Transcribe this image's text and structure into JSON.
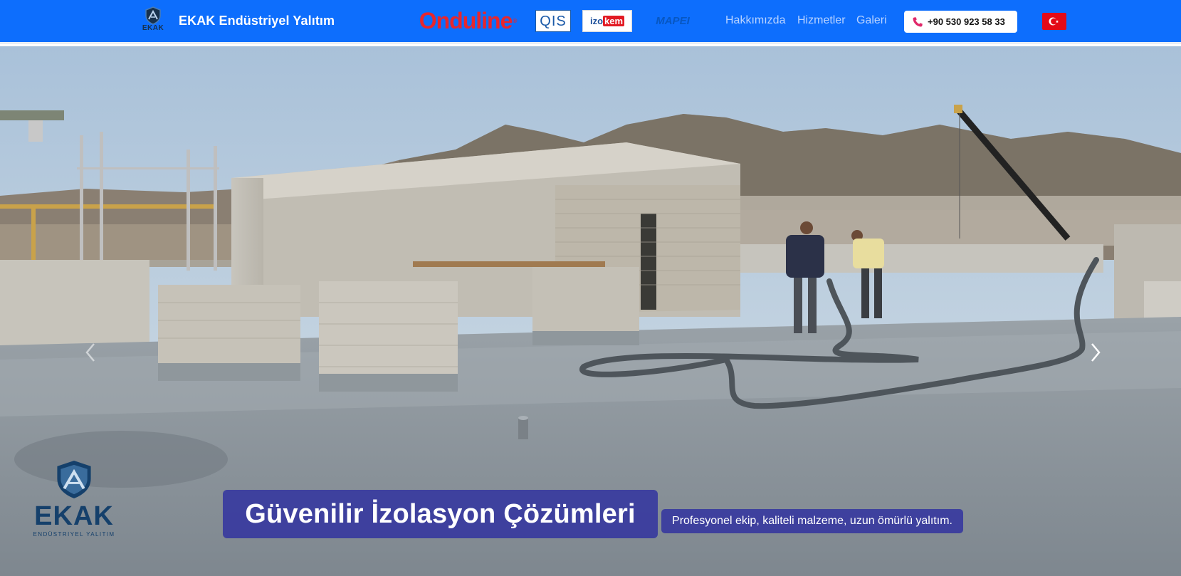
{
  "header": {
    "brand_logo_text": "EKAK",
    "brand_name": "EKAK Endüstriyel Yalıtım",
    "partners": {
      "onduline": "Onduline",
      "qis": "QIS",
      "izokem_a": "izo",
      "izokem_b": "kem",
      "mapei": "MAPEI"
    },
    "nav": [
      "Hakkımızda",
      "Hizmetler",
      "Galeri"
    ],
    "phone": "+90 530 923 58 33",
    "language_flag": "turkish-flag-icon"
  },
  "hero": {
    "title": "Güvenilir İzolasyon Çözümleri",
    "subtitle": "Profesyonel ekip, kaliteli malzeme, uzun ömürlü yalıtım.",
    "logo_word": "EKAK",
    "logo_sub": "ENDÜSTRIYEL YALITIM",
    "prev_icon": "chevron-left-icon",
    "next_icon": "chevron-right-icon"
  },
  "colors": {
    "header_bg": "#0d6efd",
    "caption_bg": "#2e30a0",
    "flag_red": "#e30a17",
    "onduline_red": "#e8262d"
  }
}
